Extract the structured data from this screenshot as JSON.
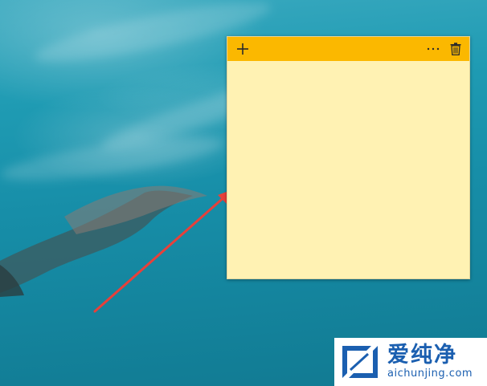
{
  "desktop": {
    "wallpaper": "underwater-freediver",
    "water_color": "#1b94ad"
  },
  "sticky_note": {
    "header_color": "#fbb800",
    "body_color": "#fff2b3",
    "new_note_icon": "plus-icon",
    "menu_icon": "more-options-icon",
    "menu_label": "···",
    "delete_icon": "trash-icon",
    "content": ""
  },
  "annotation": {
    "arrow_color": "#e8403a"
  },
  "watermark": {
    "title": "爱纯净",
    "url": "aichunjing.com",
    "color": "#1b5fb0"
  }
}
